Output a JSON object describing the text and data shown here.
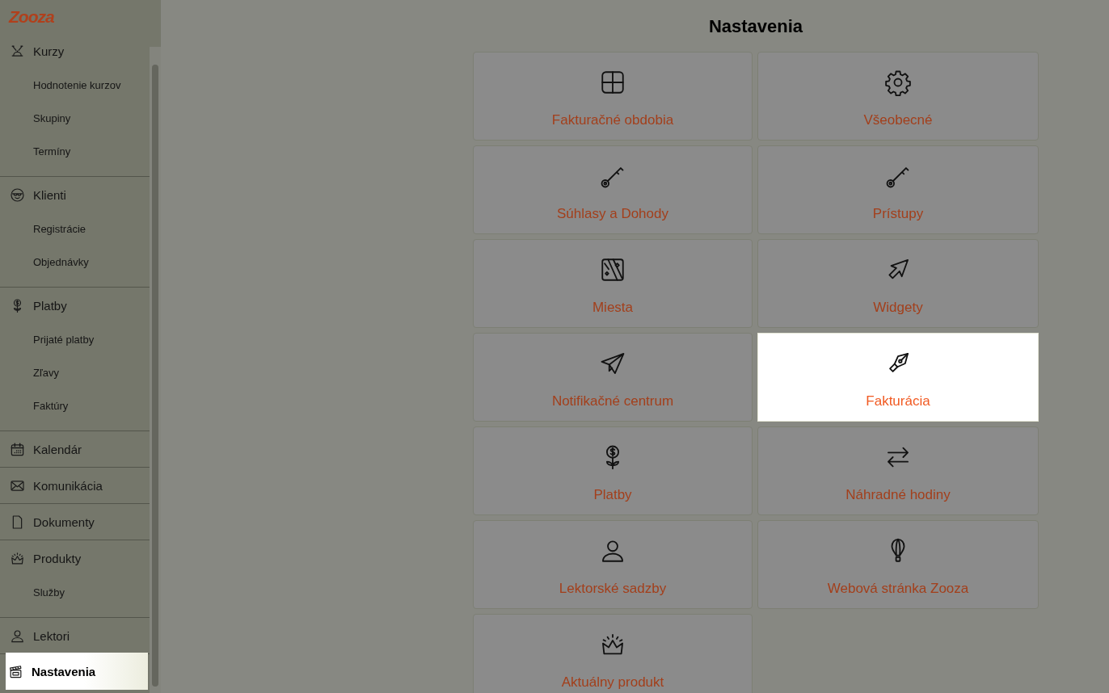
{
  "logo": {
    "text": "Zooza"
  },
  "sidebar": {
    "sections": [
      {
        "label": "Kurzy",
        "selected": false,
        "children": [
          {
            "label": "Hodnotenie kurzov",
            "selected": false
          },
          {
            "label": "Skupiny",
            "selected": false
          },
          {
            "label": "Termíny",
            "selected": false
          }
        ]
      },
      {
        "label": "Klienti",
        "selected": false,
        "children": [
          {
            "label": "Registrácie",
            "selected": false
          },
          {
            "label": "Objednávky",
            "selected": false
          }
        ]
      },
      {
        "label": "Platby",
        "selected": false,
        "children": [
          {
            "label": "Prijaté platby",
            "selected": false
          },
          {
            "label": "Zľavy",
            "selected": false
          },
          {
            "label": "Faktúry",
            "selected": false
          }
        ]
      },
      {
        "label": "Kalendár",
        "selected": false
      },
      {
        "label": "Komunikácia",
        "selected": false
      },
      {
        "label": "Dokumenty",
        "selected": false
      },
      {
        "label": "Produkty",
        "selected": false,
        "children": [
          {
            "label": "Služby",
            "selected": false
          }
        ]
      },
      {
        "label": "Lektori",
        "selected": false
      },
      {
        "label": "Nastavenia",
        "selected": true
      }
    ]
  },
  "page_title": "Nastavenia",
  "tiles": [
    {
      "label": "Fakturačné obdobia",
      "highlighted": false
    },
    {
      "label": "Všeobecné",
      "highlighted": false
    },
    {
      "label": "Súhlasy a Dohody",
      "highlighted": false
    },
    {
      "label": "Prístupy",
      "highlighted": false
    },
    {
      "label": "Miesta",
      "highlighted": false
    },
    {
      "label": "Widgety",
      "highlighted": false
    },
    {
      "label": "Notifikačné centrum",
      "highlighted": false
    },
    {
      "label": "Fakturácia",
      "highlighted": true
    },
    {
      "label": "Platby",
      "highlighted": false
    },
    {
      "label": "Náhradné hodiny",
      "highlighted": false
    },
    {
      "label": "Lektorské sadzby",
      "highlighted": false
    },
    {
      "label": "Webová stránka Zooza",
      "highlighted": false
    },
    {
      "label": "Aktuálny produkt",
      "highlighted": false
    }
  ]
}
